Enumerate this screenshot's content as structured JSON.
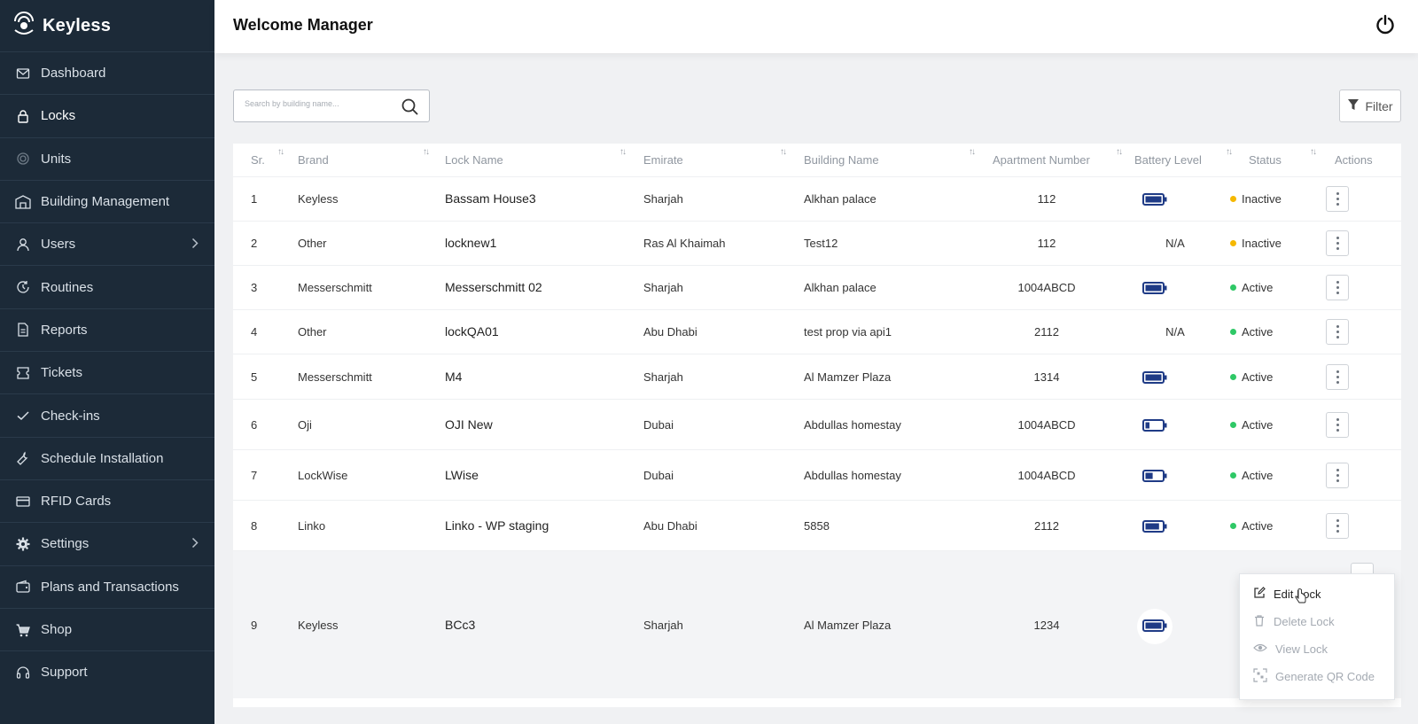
{
  "app": {
    "name": "Keyless"
  },
  "header": {
    "title": "Welcome Manager"
  },
  "sidebar": {
    "items": [
      {
        "label": "Dashboard",
        "icon": "mail-icon",
        "active": false
      },
      {
        "label": "Locks",
        "icon": "lock-icon",
        "active": true
      },
      {
        "label": "Units",
        "icon": "units-icon",
        "active": false
      },
      {
        "label": "Building Management",
        "icon": "building-icon",
        "active": false
      },
      {
        "label": "Users",
        "icon": "user-icon",
        "active": false,
        "expandable": true
      },
      {
        "label": "Routines",
        "icon": "routine-icon",
        "active": false
      },
      {
        "label": "Reports",
        "icon": "report-icon",
        "active": false
      },
      {
        "label": "Tickets",
        "icon": "ticket-icon",
        "active": false
      },
      {
        "label": "Check-ins",
        "icon": "check-icon",
        "active": false
      },
      {
        "label": "Schedule Installation",
        "icon": "tool-icon",
        "active": false
      },
      {
        "label": "RFID Cards",
        "icon": "card-icon",
        "active": false
      },
      {
        "label": "Settings",
        "icon": "gear-icon",
        "active": false,
        "expandable": true
      },
      {
        "label": "Plans and Transactions",
        "icon": "wallet-icon",
        "active": false
      },
      {
        "label": "Shop",
        "icon": "cart-icon",
        "active": false
      },
      {
        "label": "Support",
        "icon": "headset-icon",
        "active": false
      }
    ]
  },
  "search": {
    "placeholder": "Search by building name..."
  },
  "filter": {
    "label": "Filter"
  },
  "table": {
    "headers": [
      "Sr.",
      "Brand",
      "Lock Name",
      "Emirate",
      "Building Name",
      "Apartment Number",
      "Battery Level",
      "Status",
      "Actions"
    ],
    "rows": [
      {
        "sr": "1",
        "brand": "Keyless",
        "lock": "Bassam House3",
        "emirate": "Sharjah",
        "building": "Alkhan palace",
        "apt": "112",
        "battery": "full",
        "battery_text": "",
        "status": "Inactive"
      },
      {
        "sr": "2",
        "brand": "Other",
        "lock": "locknew1",
        "emirate": "Ras Al Khaimah",
        "building": "Test12",
        "apt": "112",
        "battery": "none",
        "battery_text": "N/A",
        "status": "Inactive"
      },
      {
        "sr": "3",
        "brand": "Messerschmitt",
        "lock": "Messerschmitt 02",
        "emirate": "Sharjah",
        "building": "Alkhan palace",
        "apt": "1004ABCD",
        "battery": "full",
        "battery_text": "",
        "status": "Active"
      },
      {
        "sr": "4",
        "brand": "Other",
        "lock": "lockQA01",
        "emirate": "Abu Dhabi",
        "building": "test prop via api1",
        "apt": "2112",
        "battery": "none",
        "battery_text": "N/A",
        "status": "Active"
      },
      {
        "sr": "5",
        "brand": "Messerschmitt",
        "lock": "M4",
        "emirate": "Sharjah",
        "building": "Al Mamzer Plaza",
        "apt": "1314",
        "battery": "full",
        "battery_text": "",
        "status": "Active"
      },
      {
        "sr": "6",
        "brand": "Oji",
        "lock": "OJI New",
        "emirate": "Dubai",
        "building": "Abdullas homestay",
        "apt": "1004ABCD",
        "battery": "low",
        "battery_text": "",
        "status": "Active"
      },
      {
        "sr": "7",
        "brand": "LockWise",
        "lock": "LWise",
        "emirate": "Dubai",
        "building": "Abdullas homestay",
        "apt": "1004ABCD",
        "battery": "mid",
        "battery_text": "",
        "status": "Active"
      },
      {
        "sr": "8",
        "brand": "Linko",
        "lock": "Linko - WP staging",
        "emirate": "Abu Dhabi",
        "building": "5858",
        "apt": "2112",
        "battery": "high",
        "battery_text": "",
        "status": "Active"
      },
      {
        "sr": "9",
        "brand": "Keyless",
        "lock": "BCc3",
        "emirate": "Sharjah",
        "building": "Al Mamzer Plaza",
        "apt": "1234",
        "battery": "full",
        "battery_text": "",
        "status": ""
      }
    ]
  },
  "dropdown": {
    "items": [
      {
        "label": "Edit Lock",
        "icon": "edit-icon"
      },
      {
        "label": "Delete Lock",
        "icon": "trash-icon"
      },
      {
        "label": "View Lock",
        "icon": "eye-icon"
      },
      {
        "label": "Generate QR Code",
        "icon": "qr-icon"
      }
    ]
  },
  "colors": {
    "sidebar_bg": "#1c2a38",
    "battery": "#1f3b86",
    "active": "#2ec866",
    "inactive": "#f5b800"
  }
}
